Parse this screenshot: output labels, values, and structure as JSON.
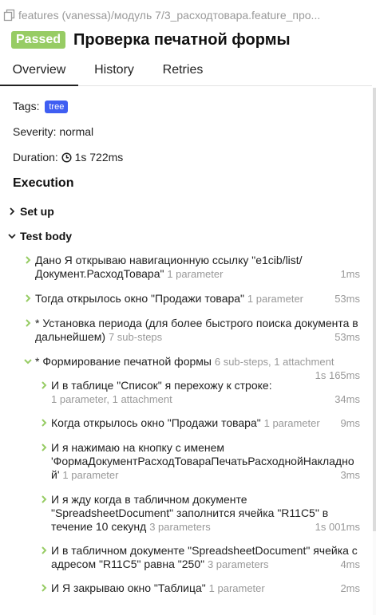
{
  "breadcrumb": "features (vanessa)/модуль 7/3_расходтовара.feature_про...",
  "header": {
    "status": "Passed",
    "title": "Проверка печатной формы"
  },
  "tabs": [
    "Overview",
    "History",
    "Retries"
  ],
  "info": {
    "tags_label": "Tags:",
    "tag": "tree",
    "severity_label": "Severity:",
    "severity": "normal",
    "duration_label": "Duration:",
    "duration": "1s 722ms"
  },
  "execution": {
    "title": "Execution",
    "setup": "Set up",
    "body": "Test body",
    "steps": [
      {
        "lines": [
          "Дано Я открываю навигационную ссылку \"e1cib/list/",
          "Документ.РасходТовара\""
        ],
        "meta": "1 parameter",
        "duration": "1ms"
      },
      {
        "lines": [
          "Тогда открылось окно \"Продажи товара\""
        ],
        "meta": "1 parameter",
        "duration": "53ms"
      },
      {
        "lines": [
          "* Установка периода (для более быстрого поиска документа в",
          "дальнейшем)"
        ],
        "meta": "7 sub-steps",
        "duration": "53ms"
      },
      {
        "lines": [
          "* Формирование печатной формы"
        ],
        "meta": "6 sub-steps, 1 attachment",
        "duration": "1s 165ms"
      }
    ],
    "substeps": [
      {
        "lines": [
          "И в таблице \"Список\" я перехожу к строке:"
        ],
        "meta": "1 parameter, 1 attachment",
        "duration": "34ms"
      },
      {
        "lines": [
          "Когда открылось окно \"Продажи товара\""
        ],
        "meta": "1 parameter",
        "duration": "9ms"
      },
      {
        "lines": [
          "И я нажимаю на кнопку с именем",
          "'ФормаДокументРасходТовараПечатьРасходнойНакладно",
          "й'"
        ],
        "meta": "1 parameter",
        "duration": "3ms"
      },
      {
        "lines": [
          "И я жду когда в табличном документе",
          "\"SpreadsheetDocument\" заполнится ячейка \"R11C5\" в",
          "течение 10 секунд"
        ],
        "meta": "3 parameters",
        "duration": "1s 001ms"
      },
      {
        "lines": [
          "И в табличном документе \"SpreadsheetDocument\" ячейка с",
          "адресом \"R11C5\" равна \"250\""
        ],
        "meta": "3 parameters",
        "duration": "4ms"
      },
      {
        "lines": [
          "И Я закрываю окно \"Таблица\""
        ],
        "meta": "1 parameter",
        "duration": "2ms"
      }
    ]
  },
  "colors": {
    "passed": "#97cc64",
    "tag": "#3f5ef2",
    "step_chevron": "#97cc64"
  }
}
